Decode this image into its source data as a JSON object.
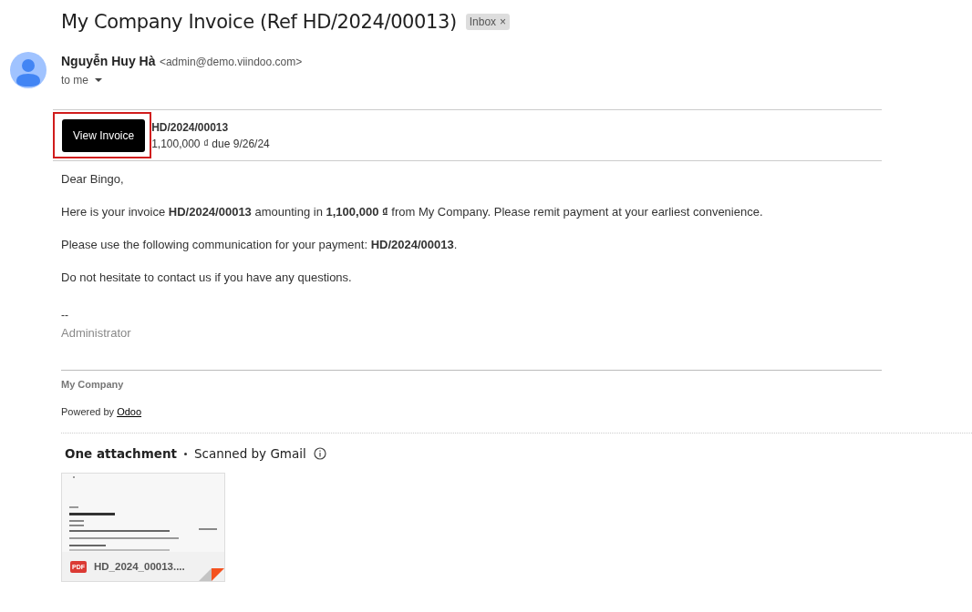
{
  "subject": "My Company Invoice (Ref HD/2024/00013)",
  "label": {
    "text": "Inbox",
    "close": "×"
  },
  "sender": {
    "name": "Nguyễn Huy Hà",
    "email": "<admin@demo.viindoo.com>",
    "recipient": "to me"
  },
  "invoice_box": {
    "button": "View Invoice",
    "highlighted": true,
    "ref": "HD/2024/00013",
    "amount": "1,100,000 ₫ due 9/26/24"
  },
  "body": [
    "Dear Bingo,",
    "Here is your invoice **HD/2024/00013** amounting in **1,100,000 ₫** from My Company. Please remit payment at your earliest convenience.",
    "Please use the following communication for your payment: **HD/2024/00013**.",
    "Do not hesitate to contact us if you have any questions."
  ],
  "signature": {
    "dashes": "--",
    "name": "Administrator"
  },
  "footer": {
    "company": "My Company",
    "powered": "Powered by",
    "link": "Odoo"
  },
  "attachments": {
    "title": "One attachment",
    "scan": "Scanned by Gmail",
    "files": [
      {
        "kind": "pdf",
        "badge": "PDF",
        "name": "HD_2024_00013...."
      }
    ]
  }
}
